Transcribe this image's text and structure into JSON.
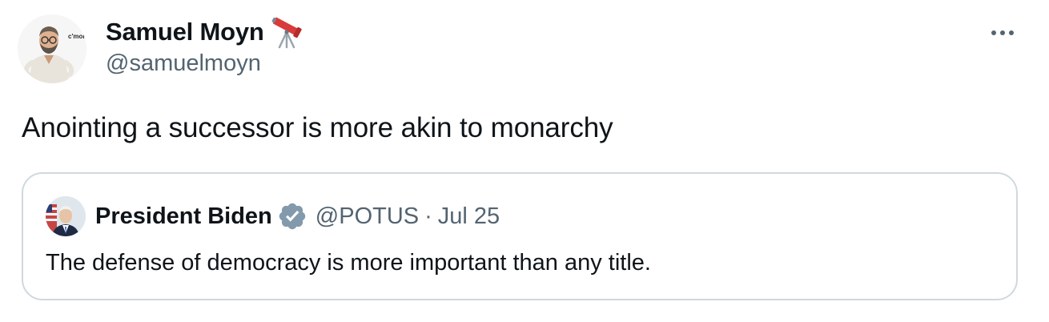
{
  "author": {
    "display_name": "Samuel Moyn",
    "handle": "@samuelmoyn",
    "name_emoji": "telescope-icon",
    "avatar_caption": "c'mon."
  },
  "tweet": {
    "text": "Anointing a successor is more akin to monarchy"
  },
  "quoted": {
    "display_name": "President Biden",
    "handle": "@POTUS",
    "separator": "·",
    "date": "Jul 25",
    "text": "The defense of democracy is more important than any title.",
    "verified_icon": "gray-verified-badge-icon"
  },
  "menu": {
    "icon": "more-options-icon"
  },
  "colors": {
    "text_primary": "#0f1419",
    "text_secondary": "#536471",
    "border": "#cfd9de",
    "verified_gray": "#829aab"
  }
}
